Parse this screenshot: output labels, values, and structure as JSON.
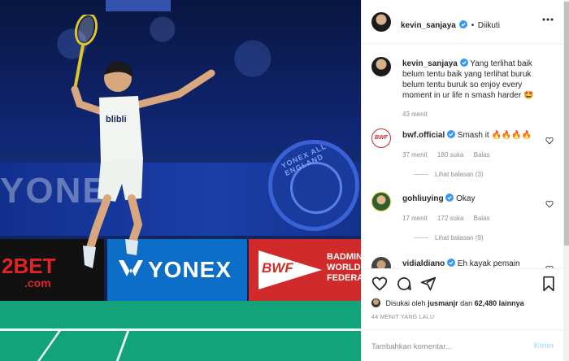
{
  "post": {
    "author": "kevin_sanjaya",
    "follow_state": "Diikuti",
    "separator": "•",
    "caption_author": "kevin_sanjaya",
    "caption": "Yang terlihat baik belum tentu baik yang terlihat buruk belum tentu buruk so enjoy every moment in ur life n smash harder 🤩",
    "caption_time": "43 menit"
  },
  "photo": {
    "ads": {
      "bet_text": "2BET",
      "bet_sub": ".com",
      "yonex_text": "YONEX",
      "bwf_tag": "BWF",
      "bwf_side": "BADMIN\nWORLD\nFEDERA"
    },
    "bg_banner_text": "YONE",
    "emblem_text": "YONEX ALL ENGLAND",
    "shirt_text": "blibli"
  },
  "comments": [
    {
      "user": "bwf.official",
      "text": "Smash it 🔥🔥🔥🔥",
      "time": "37 menit",
      "likes": "180 suka",
      "reply": "Balas",
      "view_replies": "Lihat balasan (3)"
    },
    {
      "user": "gohliuying",
      "text": "Okay",
      "time": "17 menit",
      "likes": "172 suka",
      "reply": "Balas",
      "view_replies": "Lihat balasan (9)"
    },
    {
      "user": "vidialdiano",
      "text": "Eh kayak pemain"
    }
  ],
  "footer": {
    "liked_by_prefix": "Disukai oleh",
    "liked_by_user": "jusmanjr",
    "liked_by_mid": "dan",
    "liked_by_count": "62,480 lainnya",
    "time_ago": "44 MENIT YANG LALU",
    "comment_placeholder": "Tambahkan komentar...",
    "send_label": "Kirim"
  },
  "colors": {
    "verified": "#3897f0",
    "link_blue_disabled": "#b2dffc",
    "muted": "#8e8e8e",
    "court": "#12a37a"
  },
  "icons": [
    "heart-icon",
    "comment-icon",
    "share-icon",
    "bookmark-icon",
    "more-icon",
    "verified-icon"
  ]
}
